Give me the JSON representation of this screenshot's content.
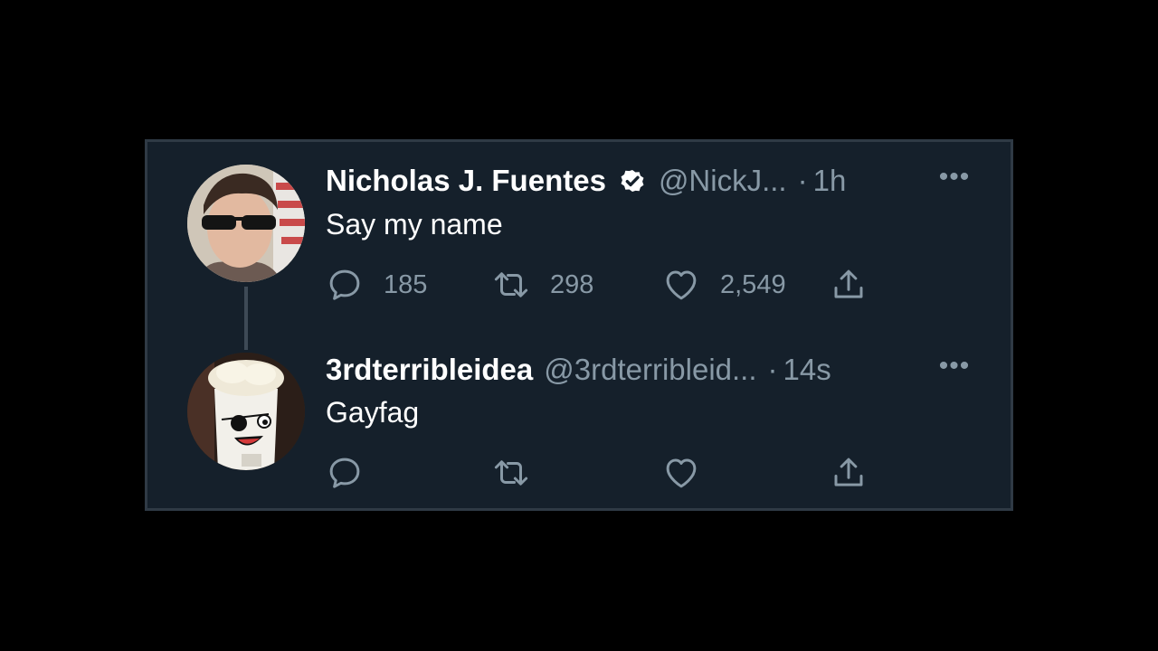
{
  "tweets": [
    {
      "name": "Nicholas J. Fuentes",
      "verified": true,
      "handle": "@NickJ...",
      "separator": "·",
      "time": "1h",
      "more": "•••",
      "text": "Say my name",
      "stats": {
        "replies": "185",
        "retweets": "298",
        "likes": "2,549"
      }
    },
    {
      "name": "3rdterribleidea",
      "verified": false,
      "handle": "@3rdterribleid...",
      "separator": "·",
      "time": "14s",
      "more": "•••",
      "text": "Gayfag",
      "stats": {
        "replies": "",
        "retweets": "",
        "likes": ""
      }
    }
  ],
  "colors": {
    "background": "#000000",
    "card": "#15202b",
    "border": "#2f3a45",
    "text_primary": "#ffffff",
    "text_secondary": "#8899a6",
    "thread_line": "#3e4a56"
  },
  "icons": [
    "verified-badge-icon",
    "reply-icon",
    "retweet-icon",
    "like-icon",
    "share-icon",
    "more-icon"
  ]
}
